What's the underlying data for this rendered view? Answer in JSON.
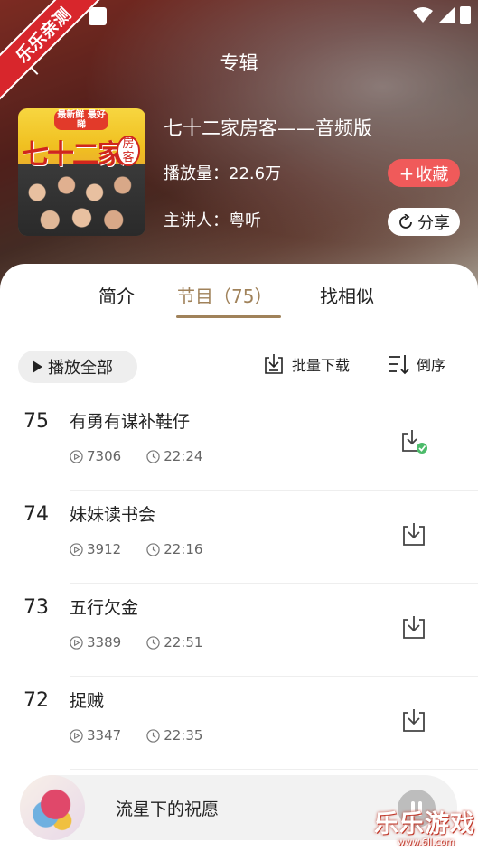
{
  "header": {
    "title": "专辑",
    "watermark_ribbon": "乐乐亲测"
  },
  "album": {
    "cover_badge": "最新鲜 最好睇",
    "cover_title": "七十二家",
    "cover_sub": "房客",
    "title": "七十二家房客——音频版",
    "play_count": "播放量：22.6万",
    "speaker": "主讲人：粤听",
    "collect_label": "收藏",
    "share_label": "分享"
  },
  "tabs": [
    {
      "label": "简介",
      "active": false
    },
    {
      "label": "节目（75）",
      "active": true
    },
    {
      "label": "找相似",
      "active": false
    }
  ],
  "toolbar": {
    "play_all_label": "播放全部",
    "batch_download_label": "批量下载",
    "reverse_label": "倒序"
  },
  "episodes": [
    {
      "num": "75",
      "title": "有勇有谋补鞋仔",
      "plays": "7306",
      "duration": "22:24",
      "downloaded": true
    },
    {
      "num": "74",
      "title": "妹妹读书会",
      "plays": "3912",
      "duration": "22:16",
      "downloaded": false
    },
    {
      "num": "73",
      "title": "五行欠金",
      "plays": "3389",
      "duration": "22:51",
      "downloaded": false
    },
    {
      "num": "72",
      "title": "捉贼",
      "plays": "3347",
      "duration": "22:35",
      "downloaded": false
    }
  ],
  "player": {
    "title": "流星下的祝愿"
  },
  "brand_watermark": {
    "text": "乐乐游戏",
    "url": "www.6ll.com"
  },
  "colors": {
    "accent": "#a0825a",
    "collect": "#f05a5a",
    "download_done": "#4cbb6a"
  }
}
